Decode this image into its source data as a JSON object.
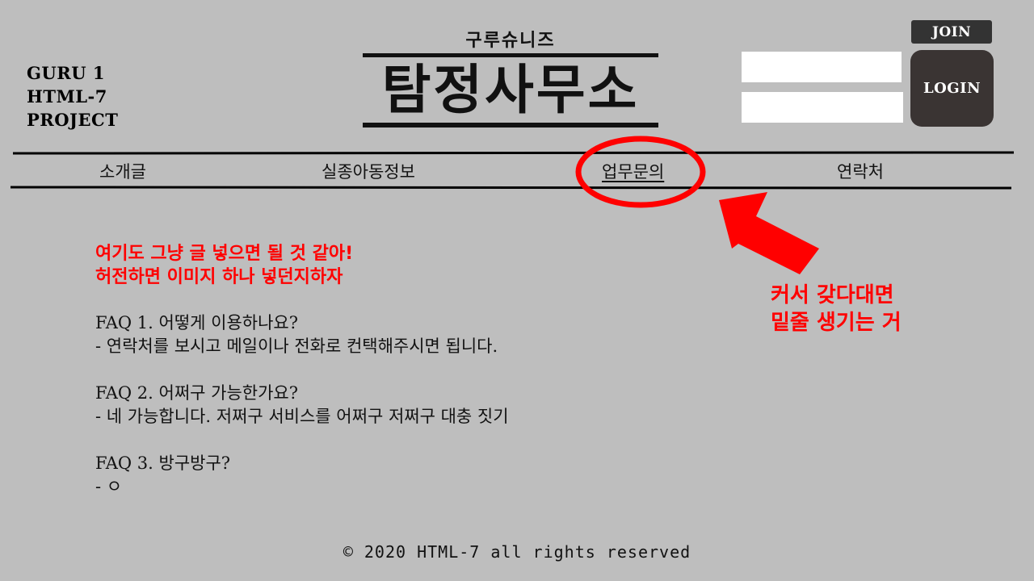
{
  "project_info": {
    "line1": "GURU 1",
    "line2": "HTML-7",
    "line3": "PROJECT"
  },
  "logo": {
    "subtitle": "구루슈니즈",
    "title": "탐정사무소"
  },
  "auth": {
    "join_label": "JOIN",
    "login_label": "LOGIN",
    "id_value": "",
    "pw_value": ""
  },
  "nav": {
    "items": [
      {
        "label": "소개글"
      },
      {
        "label": "실종아동정보"
      },
      {
        "label": "업무문의"
      },
      {
        "label": "연락처"
      }
    ]
  },
  "notes": {
    "body_line1": "여기도 그냥 글 넣으면 될 것 같아!",
    "body_line2": "허전하면 이미지 하나 넣던지하자",
    "hover_line1": "커서 갖다대면",
    "hover_line2": "밑줄 생기는 거",
    "annotation_color": "#ff0000"
  },
  "faq": [
    {
      "q": "FAQ 1. 어떻게 이용하나요?",
      "a": "- 연락처를 보시고 메일이나 전화로 컨택해주시면 됩니다."
    },
    {
      "q": "FAQ 2. 어쩌구 가능한가요?",
      "a": "- 네 가능합니다. 저쩌구 서비스를 어쩌구 저쩌구 대충 짓기"
    },
    {
      "q": "FAQ 3. 방구방구?",
      "a": "- ㅇ"
    }
  ],
  "footer": {
    "text": "© 2020 HTML-7 all rights reserved"
  },
  "colors": {
    "background": "#bebebe",
    "button_dark": "#3a3433"
  }
}
